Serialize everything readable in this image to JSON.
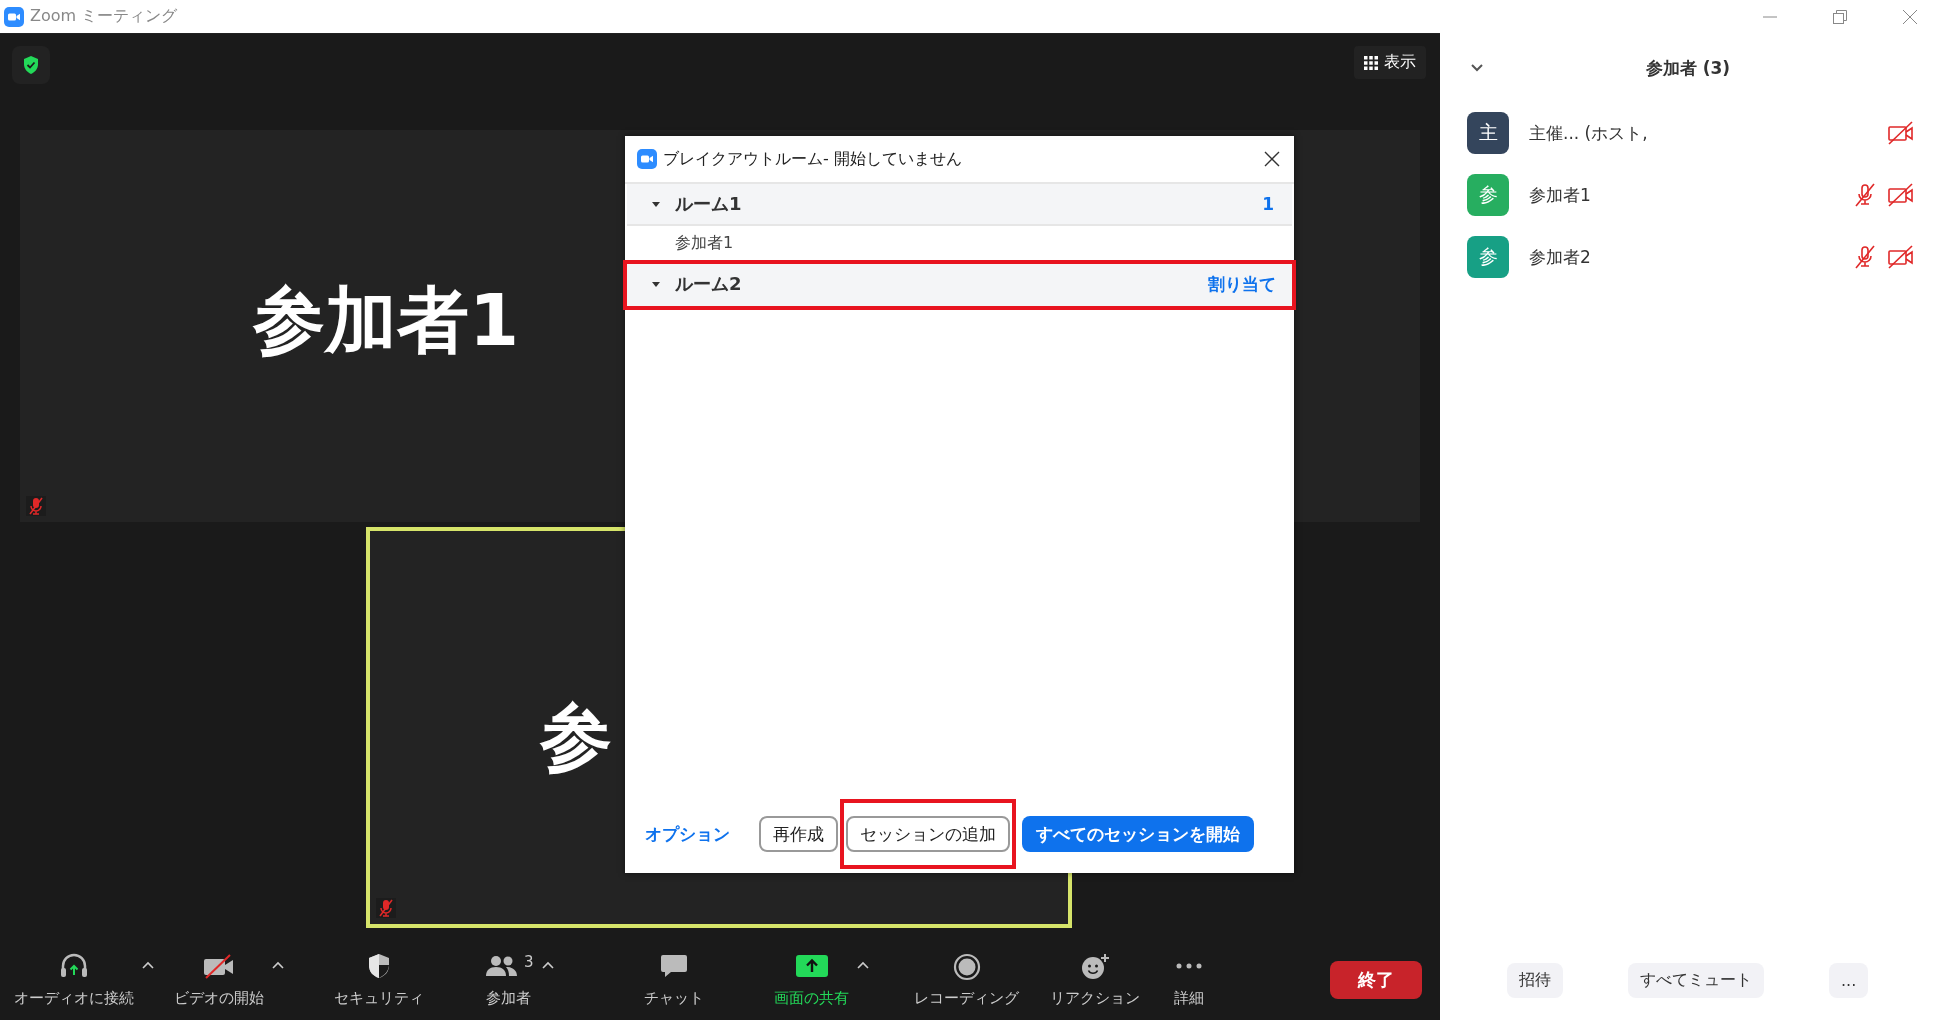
{
  "window": {
    "title": "Zoom ミーティング"
  },
  "stage": {
    "view_button": "表示",
    "tiles": [
      {
        "name": "参加者1",
        "mic_muted": true,
        "active_speaker": false
      },
      {
        "name": "参",
        "mic_muted": true,
        "active_speaker": true
      }
    ]
  },
  "dialog": {
    "title": "ブレイクアウトルーム- 開始していません",
    "rooms": [
      {
        "name": "ルーム1",
        "side_text": "1",
        "expanded": true,
        "highlighted": false,
        "children": [
          {
            "name": "参加者1"
          }
        ]
      },
      {
        "name": "ルーム2",
        "side_text": "割り当て",
        "expanded": true,
        "highlighted": true
      }
    ],
    "footer": [
      {
        "kind": "link",
        "label": "オプション",
        "highlighted": false
      },
      {
        "kind": "outline",
        "label": "再作成",
        "highlighted": false
      },
      {
        "kind": "outline",
        "label": "セッションの追加",
        "highlighted": true
      },
      {
        "kind": "primary",
        "label": "すべてのセッションを開始",
        "highlighted": false
      }
    ]
  },
  "toolbar": {
    "items": [
      {
        "label": "オーディオに接続",
        "has_menu": true,
        "active": false
      },
      {
        "label": "ビデオの開始",
        "has_menu": true,
        "active": false
      },
      {
        "label": "セキュリティ",
        "has_menu": false,
        "active": false
      },
      {
        "label": "参加者",
        "count": "3",
        "has_menu": true,
        "active": false
      },
      {
        "label": "チャット",
        "has_menu": false,
        "active": false
      },
      {
        "label": "画面の共有",
        "has_menu": true,
        "active": true
      },
      {
        "label": "レコーディング",
        "has_menu": false,
        "active": false
      },
      {
        "label": "リアクション",
        "has_menu": false,
        "active": false
      },
      {
        "label": "詳細",
        "has_menu": false,
        "active": false
      }
    ],
    "end_button": "終了"
  },
  "participants_panel": {
    "title": "参加者 (3)",
    "participants": [
      {
        "avatar": "主",
        "color": "#34455c",
        "name": "主催... (ホスト,",
        "video_off": true
      },
      {
        "avatar": "参",
        "color": "#27ae60",
        "name": "参加者1",
        "mic_muted": true,
        "video_off": true
      },
      {
        "avatar": "参",
        "color": "#17a085",
        "name": "参加者2",
        "mic_muted": true,
        "video_off": true
      }
    ],
    "buttons": [
      "招待",
      "すべてミュート",
      "..."
    ]
  }
}
